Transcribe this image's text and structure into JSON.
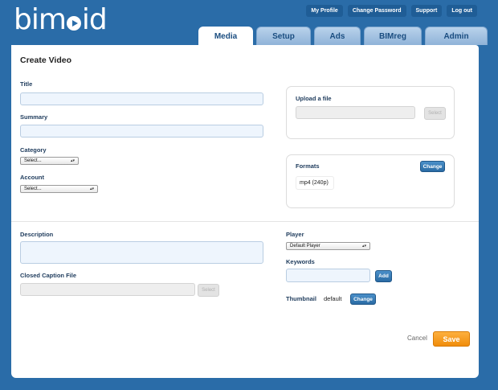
{
  "logo": {
    "text_left": "bim",
    "text_right": "id"
  },
  "topnav": [
    "My Profile",
    "Change Password",
    "Support",
    "Log out"
  ],
  "tabs": [
    {
      "label": "Media",
      "active": true
    },
    {
      "label": "Setup",
      "active": false
    },
    {
      "label": "Ads",
      "active": false
    },
    {
      "label": "BIMreg",
      "active": false
    },
    {
      "label": "Admin",
      "active": false
    }
  ],
  "page_title": "Create Video",
  "form": {
    "title_label": "Title",
    "title_value": "",
    "summary_label": "Summary",
    "summary_value": "",
    "category_label": "Category",
    "category_selected": "Select...",
    "account_label": "Account",
    "account_selected": "Select...",
    "upload_label": "Upload a file",
    "upload_button": "Select",
    "formats_label": "Formats",
    "formats_change": "Change",
    "formats_items": [
      "mp4 (240p)"
    ],
    "description_label": "Description",
    "description_value": "",
    "caption_label": "Closed Caption File",
    "caption_button": "Select",
    "player_label": "Player",
    "player_selected": "Default Player",
    "keywords_label": "Keywords",
    "keywords_value": "",
    "keywords_add": "Add",
    "thumbnail_label": "Thumbnail",
    "thumbnail_value": "default",
    "thumbnail_change": "Change"
  },
  "actions": {
    "cancel": "Cancel",
    "save": "Save"
  },
  "colors": {
    "background": "#2a6ca8",
    "primary_button": "#2a6ba4",
    "save_button": "#f08c0a",
    "input_bg": "#eef5fd"
  }
}
